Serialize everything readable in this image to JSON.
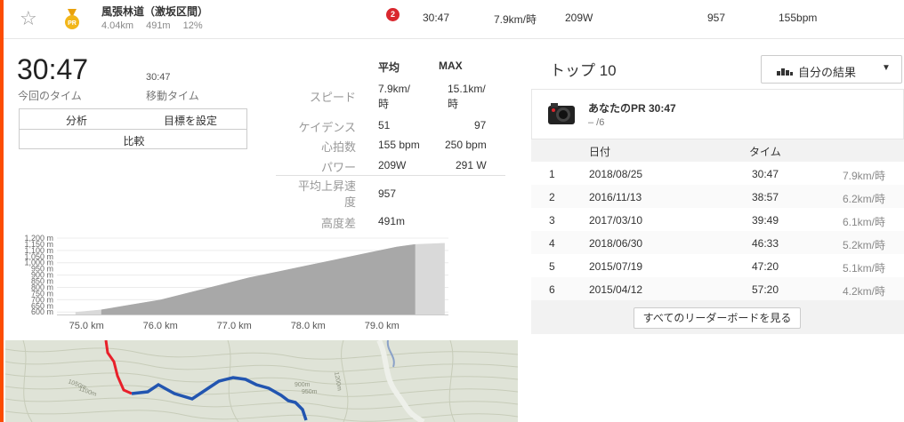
{
  "segment": {
    "name": "風張林道（激坂区間）",
    "distance": "4.04km",
    "elev_gain": "491m",
    "grade": "12%",
    "pr_badge": "PR",
    "rank": "2",
    "time": "30:47",
    "speed": "7.9km/時",
    "power": "209W",
    "cadence": "957",
    "heartrate": "155bpm"
  },
  "stats": {
    "elapsed_time": "30:47",
    "elapsed_label": "今回のタイム",
    "moving_time": "30:47",
    "moving_label": "移動タイム",
    "buttons": {
      "analysis": "分析",
      "set_goal": "目標を設定",
      "compare": "比較"
    },
    "head_avg": "平均",
    "head_max": "MAX",
    "rows": {
      "speed_label": "スピード",
      "speed_avg": "7.9km/時",
      "speed_max": "15.1km/時",
      "cadence_label": "ケイデンス",
      "cadence_avg": "51",
      "cadence_max": "97",
      "hr_label": "心拍数",
      "hr_avg": "155 bpm",
      "hr_max": "250 bpm",
      "power_label": "パワー",
      "power_avg": "209W",
      "power_max": "291 W",
      "vam_label": "平均上昇速度",
      "vam_avg": "957",
      "elev_label": "高度差",
      "elev_avg": "491m"
    }
  },
  "chart_data": {
    "type": "area",
    "x": [
      74.85,
      75.2,
      75.6,
      76.0,
      76.4,
      76.8,
      77.2,
      77.6,
      78.0,
      78.4,
      78.8,
      79.2,
      79.45,
      79.85
    ],
    "y": [
      600,
      620,
      660,
      700,
      760,
      820,
      880,
      930,
      980,
      1030,
      1080,
      1130,
      1150,
      1160
    ],
    "highlight_range": [
      75.2,
      79.45
    ],
    "xlim": [
      74.6,
      79.9
    ],
    "ylim": [
      580,
      1200
    ],
    "xticks": [
      "75.0 km",
      "76.0 km",
      "77.0 km",
      "78.0 km",
      "79.0 km"
    ],
    "xtick_values": [
      75.0,
      76.0,
      77.0,
      78.0,
      79.0
    ],
    "yticks": [
      "1,200 m",
      "1,100 m",
      "1,000 m",
      "900 m",
      "800 m",
      "700 m",
      "600 m"
    ],
    "ytick_values": [
      1200,
      1100,
      1000,
      900,
      800,
      700,
      600
    ],
    "minor_yticks": [
      "1,150 m",
      "1,050 m",
      "950 m",
      "850 m",
      "750 m",
      "650 m"
    ],
    "minor_ytick_values": [
      1150,
      1050,
      950,
      850,
      750,
      650
    ],
    "fill_color": "#a8a8a8",
    "fade_color": "#d9d9d9"
  },
  "map": {
    "contour_labels": [
      "1050m",
      "1100m",
      "900m",
      "950m",
      "1200m"
    ]
  },
  "leaderboard": {
    "title": "トップ 10",
    "filter_label": "自分の結果",
    "pr_title": "あなたのPR 30:47",
    "pr_sub": "– /6",
    "col_date": "日付",
    "col_time": "タイム",
    "rows": [
      {
        "rank": "1",
        "date": "2018/08/25",
        "time": "30:47",
        "speed": "7.9km/時"
      },
      {
        "rank": "2",
        "date": "2016/11/13",
        "time": "38:57",
        "speed": "6.2km/時"
      },
      {
        "rank": "3",
        "date": "2017/03/10",
        "time": "39:49",
        "speed": "6.1km/時"
      },
      {
        "rank": "4",
        "date": "2018/06/30",
        "time": "46:33",
        "speed": "5.2km/時"
      },
      {
        "rank": "5",
        "date": "2015/07/19",
        "time": "47:20",
        "speed": "5.1km/時"
      },
      {
        "rank": "6",
        "date": "2015/04/12",
        "time": "57:20",
        "speed": "4.2km/時"
      }
    ],
    "see_all": "すべてのリーダーボードを見る"
  },
  "colors": {
    "accent": "#fc4c02",
    "rank_badge": "#d9272e",
    "pr_gold": "#f2b619",
    "route_blue": "#2255b0",
    "route_red": "#e8202a"
  },
  "icons": [
    "star-icon",
    "pr-medal-icon",
    "bar-chart-icon",
    "chevron-down-icon",
    "camera-avatar-icon"
  ]
}
